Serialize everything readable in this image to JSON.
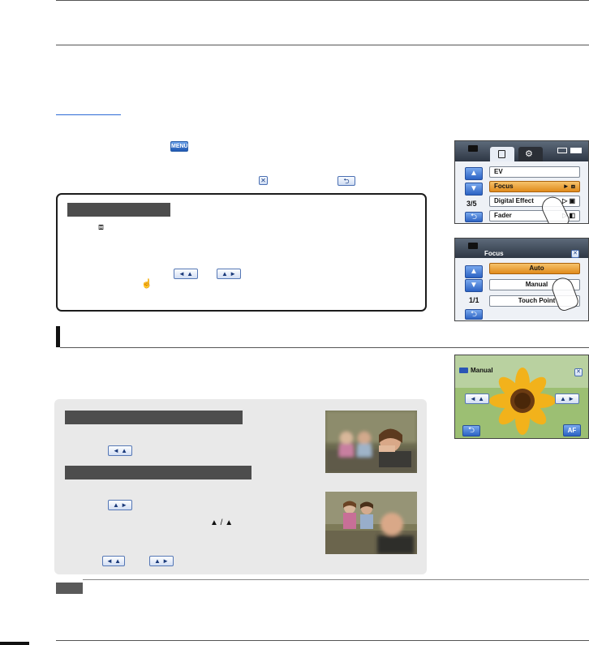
{
  "page": {
    "menu_glyph": "MENU",
    "close_glyph": "✕",
    "return_glyph": "⮌"
  },
  "tip_box": {
    "focus_icon": "⧈",
    "left_button": "◄ ▲",
    "right_button": "▲ ►",
    "touch_icon": "☝"
  },
  "screen1": {
    "items": [
      "EV",
      "Focus",
      "Digital Effect",
      "Fader"
    ],
    "page_indicator": "3/5",
    "focus_value": "► ⧈",
    "digital_value": "▷ ▣",
    "fader_value": "▷ ◧"
  },
  "screen2": {
    "title": "Focus",
    "options": [
      "Auto",
      "Manual",
      "Touch Point"
    ],
    "page_indicator": "1/1",
    "close_glyph": "✕"
  },
  "screen3": {
    "title": "Manual",
    "close_glyph": "✕",
    "af_label": "AF",
    "left_button": "◄ ▲",
    "right_button": "▲ ►",
    "return_glyph": "⮌"
  },
  "panel": {
    "button_near": "◄ ▲",
    "button_far": "▲ ►",
    "icon_pair": "▲ / ▲",
    "button_a": "◄ ▲",
    "button_b": "▲ ►"
  },
  "colors": {
    "accent_blue": "#2c63c3",
    "selection_orange": "#e08b1c",
    "label_gray": "#4d4d4d"
  }
}
